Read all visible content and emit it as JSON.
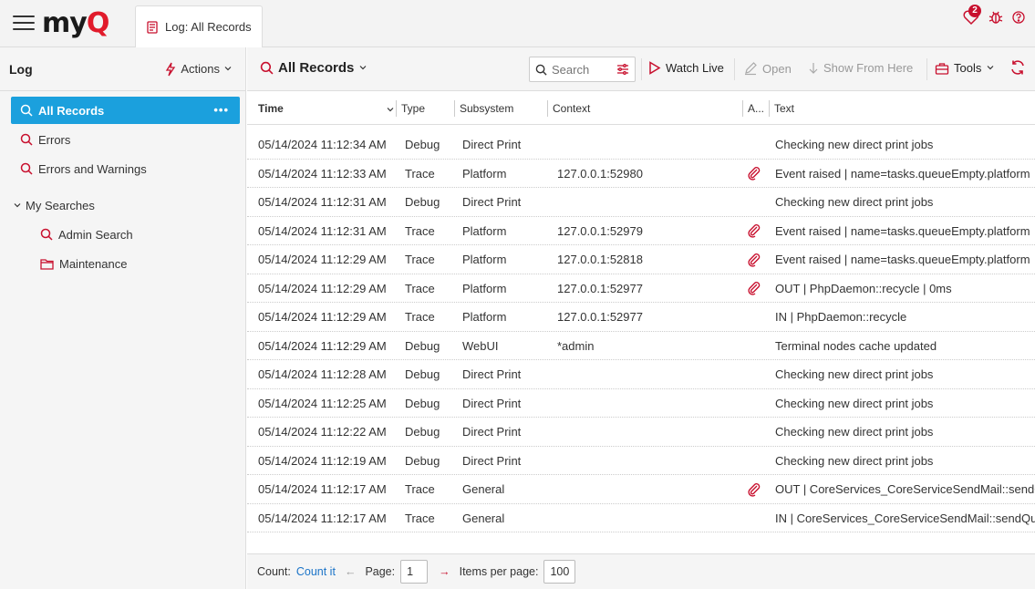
{
  "brand": {
    "logo_prefix": "my",
    "logo_q": "Q"
  },
  "tab": {
    "label": "Log: All Records"
  },
  "topbar": {
    "notifications_count": "2",
    "help_icon": "help-icon"
  },
  "left": {
    "title": "Log",
    "actions_label": "Actions",
    "items": [
      {
        "label": "All Records",
        "dots": "•••"
      },
      {
        "label": "Errors"
      },
      {
        "label": "Errors and Warnings"
      }
    ],
    "section_label": "My Searches",
    "sub_items": [
      {
        "label": "Admin Search",
        "icon": "search-icon"
      },
      {
        "label": "Maintenance",
        "icon": "folder-icon"
      }
    ]
  },
  "toolbar": {
    "view_title": "All Records",
    "search_placeholder": "Search",
    "watch_live": "Watch Live",
    "open": "Open",
    "show_from_here": "Show From Here",
    "tools": "Tools"
  },
  "table": {
    "columns": [
      "Time",
      "Type",
      "Subsystem",
      "Context",
      "A...",
      "Text"
    ],
    "rows": [
      {
        "time": "05/14/2024 11:12:34 AM",
        "type": "Debug",
        "subsystem": "Direct Print",
        "context": "",
        "attach": false,
        "text": "Checking new direct print jobs"
      },
      {
        "time": "05/14/2024 11:12:33 AM",
        "type": "Trace",
        "subsystem": "Platform",
        "context": "127.0.0.1:52980",
        "attach": true,
        "text": "Event raised | name=tasks.queueEmpty.platform"
      },
      {
        "time": "05/14/2024 11:12:31 AM",
        "type": "Debug",
        "subsystem": "Direct Print",
        "context": "",
        "attach": false,
        "text": "Checking new direct print jobs"
      },
      {
        "time": "05/14/2024 11:12:31 AM",
        "type": "Trace",
        "subsystem": "Platform",
        "context": "127.0.0.1:52979",
        "attach": true,
        "text": "Event raised | name=tasks.queueEmpty.platform"
      },
      {
        "time": "05/14/2024 11:12:29 AM",
        "type": "Trace",
        "subsystem": "Platform",
        "context": "127.0.0.1:52818",
        "attach": true,
        "text": "Event raised | name=tasks.queueEmpty.platform"
      },
      {
        "time": "05/14/2024 11:12:29 AM",
        "type": "Trace",
        "subsystem": "Platform",
        "context": "127.0.0.1:52977",
        "attach": true,
        "text": "OUT | PhpDaemon::recycle | 0ms"
      },
      {
        "time": "05/14/2024 11:12:29 AM",
        "type": "Trace",
        "subsystem": "Platform",
        "context": "127.0.0.1:52977",
        "attach": false,
        "text": "IN | PhpDaemon::recycle"
      },
      {
        "time": "05/14/2024 11:12:29 AM",
        "type": "Debug",
        "subsystem": "WebUI",
        "context": "*admin",
        "attach": false,
        "text": "Terminal nodes cache updated"
      },
      {
        "time": "05/14/2024 11:12:28 AM",
        "type": "Debug",
        "subsystem": "Direct Print",
        "context": "",
        "attach": false,
        "text": "Checking new direct print jobs"
      },
      {
        "time": "05/14/2024 11:12:25 AM",
        "type": "Debug",
        "subsystem": "Direct Print",
        "context": "",
        "attach": false,
        "text": "Checking new direct print jobs"
      },
      {
        "time": "05/14/2024 11:12:22 AM",
        "type": "Debug",
        "subsystem": "Direct Print",
        "context": "",
        "attach": false,
        "text": "Checking new direct print jobs"
      },
      {
        "time": "05/14/2024 11:12:19 AM",
        "type": "Debug",
        "subsystem": "Direct Print",
        "context": "",
        "attach": false,
        "text": "Checking new direct print jobs"
      },
      {
        "time": "05/14/2024 11:12:17 AM",
        "type": "Trace",
        "subsystem": "General",
        "context": "",
        "attach": true,
        "text": "OUT | CoreServices_CoreServiceSendMail::sendQ"
      },
      {
        "time": "05/14/2024 11:12:17 AM",
        "type": "Trace",
        "subsystem": "General",
        "context": "",
        "attach": false,
        "text": "IN | CoreServices_CoreServiceSendMail::sendQu"
      }
    ]
  },
  "footer": {
    "count_label": "Count:",
    "count_link": "Count it",
    "page_label": "Page:",
    "page_value": "1",
    "items_label": "Items per page:",
    "items_value": "100"
  },
  "colors": {
    "accent_red": "#c8102e",
    "selection_blue": "#1ba0dd",
    "link_blue": "#1b74c8"
  }
}
